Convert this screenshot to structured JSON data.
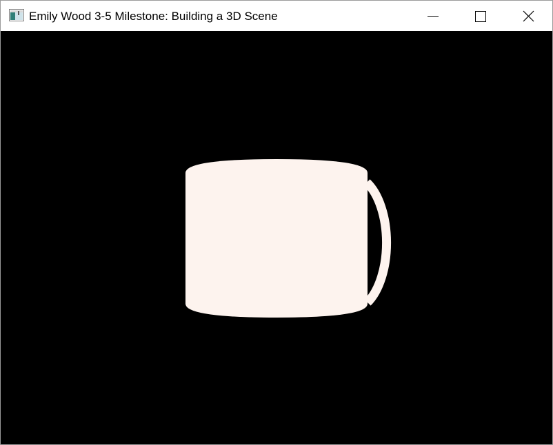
{
  "window": {
    "title": "Emily Wood 3-5 Milestone: Building a 3D Scene"
  },
  "caption_buttons": {
    "minimize_icon": "minimize-icon",
    "maximize_icon": "maximize-icon",
    "close_icon": "close-icon"
  },
  "scene": {
    "background_color": "#000000",
    "object": "mug",
    "object_color": "#fdf3ee"
  }
}
